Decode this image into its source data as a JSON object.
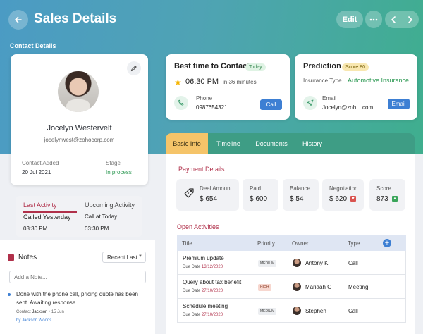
{
  "header": {
    "title": "Sales Details",
    "edit_label": "Edit"
  },
  "section_label": "Contact Details",
  "contact": {
    "name": "Jocelyn Westervelt",
    "email": "jocelynwest@zohocorp.com",
    "contact_added_label": "Contact Added",
    "contact_added_value": "20 Jul 2021",
    "stage_label": "Stage",
    "stage_value": "In process"
  },
  "best_time": {
    "title": "Best time to Contact",
    "badge": "Today",
    "time": "06:30 PM",
    "in_minutes": "in 36 minutes",
    "phone_label": "Phone",
    "phone_value": "0987654321",
    "call_button": "Call"
  },
  "prediction": {
    "title": "Prediction",
    "score_badge": "Score 80",
    "insurance_type_label": "Insurance Type",
    "insurance_type_value": "Automotive Insurance",
    "email_label": "Email",
    "email_value": "Jocelyn@zoh....com",
    "email_button": "Email"
  },
  "tabs": [
    "Basic Info",
    "Timeline",
    "Documents",
    "History"
  ],
  "payment": {
    "title": "Payment Details",
    "metrics": [
      {
        "label": "Deal Amount",
        "value": "$ 654"
      },
      {
        "label": "Paid",
        "value": "$ 600"
      },
      {
        "label": "Balance",
        "value": "$ 54"
      },
      {
        "label": "Negotiation",
        "value": "$ 620"
      },
      {
        "label": "Score",
        "value": "873"
      }
    ]
  },
  "activities": {
    "title": "Open Activities",
    "columns": [
      "Title",
      "Priority",
      "Owner",
      "Type"
    ],
    "due_label": "Due Date",
    "rows": [
      {
        "title": "Premium update",
        "due": "13/12/2020",
        "priority": "MEDIUM",
        "owner": "Antony K",
        "type": "Call"
      },
      {
        "title": "Query about tax benefit",
        "due": "27/10/2020",
        "priority": "HIGH",
        "owner": "Mariaah G",
        "type": "Meeting"
      },
      {
        "title": "Schedule meeting",
        "due": "27/10/2020",
        "priority": "MEDIUM",
        "owner": "Stephen",
        "type": "Call"
      }
    ]
  },
  "activity_summary": {
    "last_label": "Last Activity",
    "upcoming_label": "Upcoming Activity",
    "last_value": "Called Yesterday",
    "upcoming_value": "Call at Today",
    "last_time": "03:30 PM",
    "upcoming_time": "03:30 PM"
  },
  "notes": {
    "title": "Notes",
    "sort_label": "Recent Last",
    "input_placeholder": "Add a Note...",
    "items": [
      {
        "text": "Done with the phone call, pricing quote has been sent. Awaiting response.",
        "contact_label": "Contact",
        "contact": "Jackson",
        "date": "15 Jun",
        "by": "by Jackson Woods"
      }
    ]
  },
  "colors": {
    "accent": "#b0304a",
    "tab_active": "#f5c469",
    "tab_bar": "#3e9d85",
    "button_blue": "#3d7fd3"
  }
}
